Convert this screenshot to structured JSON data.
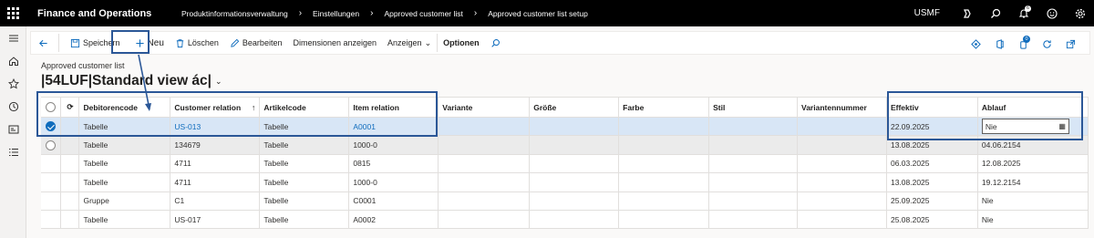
{
  "topbar": {
    "app_title": "Finance and Operations",
    "breadcrumbs": [
      "Produktinformationsverwaltung",
      "Einstellungen",
      "Approved customer list",
      "Approved customer list setup"
    ],
    "company": "USMF",
    "notification_count": "6",
    "icons": [
      "waffle-icon",
      "copilot-icon",
      "search-icon",
      "bell-icon",
      "smiley-icon",
      "gear-icon"
    ]
  },
  "leftnav": {
    "icons": [
      "hamburger-icon",
      "home-icon",
      "star-icon",
      "clock-icon",
      "workspace-icon",
      "list-icon"
    ]
  },
  "actionpane": {
    "save": "Speichern",
    "new": "Neu",
    "delete": "Löschen",
    "edit": "Bearbeiten",
    "dimensions": "Dimensionen anzeigen",
    "show": "Anzeigen",
    "options": "Optionen",
    "attachment_count": "0"
  },
  "page": {
    "caption": "Approved customer list",
    "view_title": "|54LUF|Standard view ác|"
  },
  "grid": {
    "columns": [
      "Debitorencode",
      "Customer relation",
      "Artikelcode",
      "Item relation",
      "Variante",
      "Größe",
      "Farbe",
      "Stil",
      "Variantennummer",
      "Effektiv",
      "Ablauf"
    ],
    "rows": [
      [
        "Tabelle",
        "US-013",
        "Tabelle",
        "A0001",
        "",
        "",
        "",
        "",
        "",
        "22.09.2025",
        "Nie"
      ],
      [
        "Tabelle",
        "134679",
        "Tabelle",
        "1000-0",
        "",
        "",
        "",
        "",
        "",
        "13.08.2025",
        "04.06.2154"
      ],
      [
        "Tabelle",
        "4711",
        "Tabelle",
        "0815",
        "",
        "",
        "",
        "",
        "",
        "06.03.2025",
        "12.08.2025"
      ],
      [
        "Tabelle",
        "4711",
        "Tabelle",
        "1000-0",
        "",
        "",
        "",
        "",
        "",
        "13.08.2025",
        "19.12.2154"
      ],
      [
        "Gruppe",
        "C1",
        "Tabelle",
        "C0001",
        "",
        "",
        "",
        "",
        "",
        "25.09.2025",
        "Nie"
      ],
      [
        "Tabelle",
        "US-017",
        "Tabelle",
        "A0002",
        "",
        "",
        "",
        "",
        "",
        "25.08.2025",
        "Nie"
      ]
    ]
  },
  "colors": {
    "accent": "#0f6cbd",
    "selected_row": "#d8e6f6",
    "annotation": "#2b5797"
  }
}
